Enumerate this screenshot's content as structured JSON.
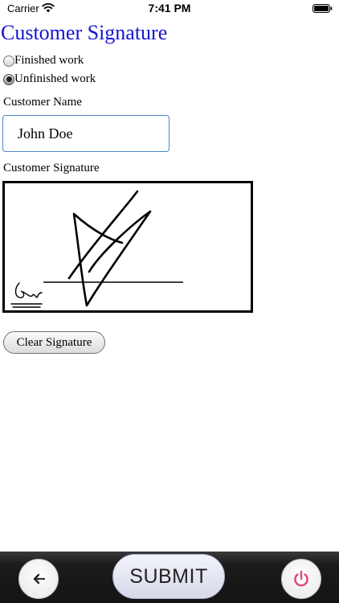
{
  "status_bar": {
    "carrier": "Carrier",
    "time": "7:41 PM",
    "icons": [
      "wifi-icon",
      "battery-icon"
    ]
  },
  "form": {
    "title": "Customer Signature",
    "work_status": {
      "options": [
        {
          "label": "Finished work",
          "checked": false
        },
        {
          "label": "Unfinished work",
          "checked": true
        }
      ]
    },
    "customer_name": {
      "label": "Customer Name",
      "value": "John Doe"
    },
    "signature": {
      "label": "Customer Signature",
      "icon": "signature-icon"
    },
    "clear_button": "Clear Signature"
  },
  "toolbar": {
    "back_icon": "arrow-left-icon",
    "submit_label": "SUBMIT",
    "power_icon": "power-icon",
    "power_color": "#e0457b"
  },
  "colors": {
    "title": "#1515d6",
    "input_border": "#4a86c7",
    "toolbar": "#141414"
  }
}
